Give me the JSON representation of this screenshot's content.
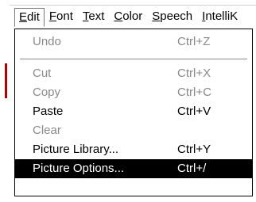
{
  "menubar": {
    "items": [
      {
        "label": "Edit",
        "access_key": "E",
        "rest": "dit"
      },
      {
        "label": "Font",
        "access_key": "F",
        "rest": "ont"
      },
      {
        "label": "Text",
        "access_key": "T",
        "rest": "ext"
      },
      {
        "label": "Color",
        "access_key": "C",
        "rest": "olor"
      },
      {
        "label": "Speech",
        "access_key": "S",
        "rest": "peech"
      },
      {
        "label": "IntelliK",
        "access_key": "I",
        "rest": "ntelliK"
      }
    ]
  },
  "edit_menu": {
    "items": [
      {
        "label": "Undo",
        "shortcut": "Ctrl+Z",
        "state": "disabled"
      },
      {
        "label": "Cut",
        "shortcut": "Ctrl+X",
        "state": "disabled"
      },
      {
        "label": "Copy",
        "shortcut": "Ctrl+C",
        "state": "disabled"
      },
      {
        "label": "Paste",
        "shortcut": "Ctrl+V",
        "state": "enabled"
      },
      {
        "label": "Clear",
        "shortcut": "",
        "state": "disabled"
      },
      {
        "label": "Picture Library...",
        "shortcut": "Ctrl+Y",
        "state": "enabled"
      },
      {
        "label": "Picture Options...",
        "shortcut": "Ctrl+/",
        "state": "selected"
      }
    ]
  },
  "colors": {
    "selected_bg": "#000000",
    "selected_fg": "#ffffff",
    "disabled_fg": "#8a8a8a"
  }
}
